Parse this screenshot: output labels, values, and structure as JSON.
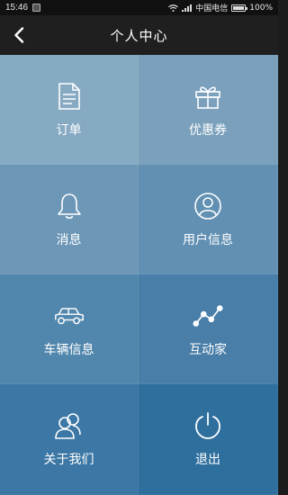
{
  "status_bar": {
    "time": "15:46",
    "carrier": "中国电信",
    "battery": "100%"
  },
  "nav": {
    "title": "个人中心"
  },
  "tiles": [
    {
      "label": "订单",
      "icon": "document-icon",
      "color": "#87aac3"
    },
    {
      "label": "优惠券",
      "icon": "gift-icon",
      "color": "#7aa0bc"
    },
    {
      "label": "消息",
      "icon": "bell-icon",
      "color": "#6c97b7"
    },
    {
      "label": "用户信息",
      "icon": "user-icon",
      "color": "#6190b3"
    },
    {
      "label": "车辆信息",
      "icon": "car-icon",
      "color": "#5287ad"
    },
    {
      "label": "互动家",
      "icon": "trend-icon",
      "color": "#487ea8"
    },
    {
      "label": "关于我们",
      "icon": "group-icon",
      "color": "#3c77a5"
    },
    {
      "label": "退出",
      "icon": "power-icon",
      "color": "#2f6f9e"
    }
  ]
}
